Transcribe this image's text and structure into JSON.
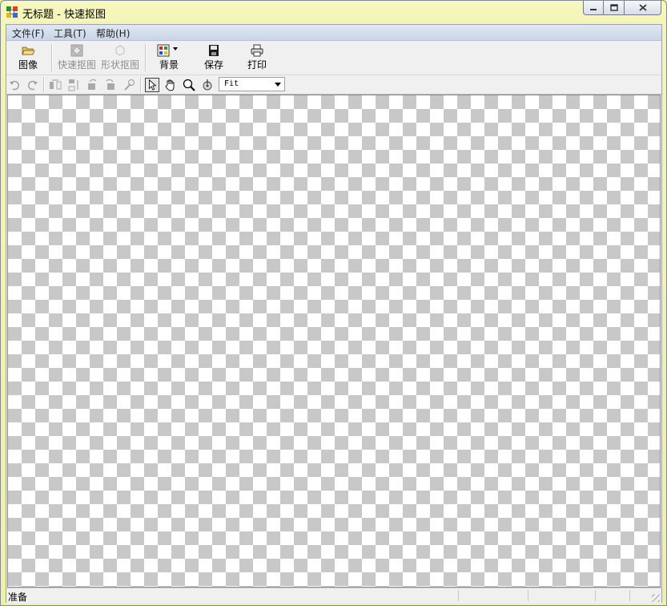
{
  "window": {
    "title": "无标题 - 快速抠图"
  },
  "menu": [
    {
      "label": "文件(F)"
    },
    {
      "label": "工具(T)"
    },
    {
      "label": "帮助(H)"
    }
  ],
  "toolbar": {
    "image": "图像",
    "quick_cutout": "快速抠图",
    "shape_cutout": "形状抠图",
    "background": "背景",
    "save": "保存",
    "print": "打印"
  },
  "toolbar2": {
    "tools": [
      "undo-icon",
      "redo-icon",
      "flip-horizontal-icon",
      "flip-vertical-icon",
      "rotate-left-icon",
      "rotate-right-icon",
      "magic-icon",
      "pointer-icon",
      "hand-icon",
      "zoom-icon",
      "reset-zoom-icon"
    ],
    "selected_tool": "pointer-icon",
    "zoom_value": "Fit"
  },
  "status": {
    "text": "准备"
  },
  "colors": {
    "title_bg": "#f4f5b4",
    "menu_bg": "#d4deeb",
    "checker": "#c8c8c8"
  }
}
